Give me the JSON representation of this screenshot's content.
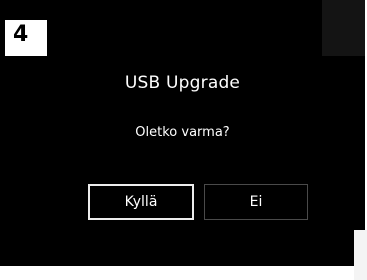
{
  "step": {
    "number": "4"
  },
  "dialog": {
    "title": "USB Upgrade",
    "message": "Oletko varma?",
    "buttons": {
      "yes_label": "Kyllä",
      "no_label": "Ei"
    },
    "selected_button": "yes"
  },
  "colors": {
    "screen_background": "#000000",
    "text": "#ffffff",
    "selected_border": "#ececec",
    "unselected_border": "#4a4a4a"
  }
}
